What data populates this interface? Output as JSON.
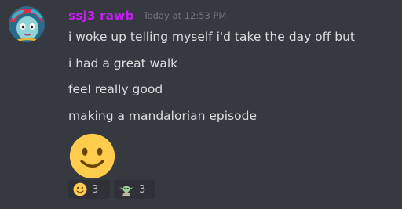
{
  "message": {
    "author": "ssj3 rawb",
    "author_color": "#c31ff0",
    "timestamp": "Today at 12:53 PM",
    "lines": [
      "i woke up telling myself i'd take the day off but",
      "i had a great walk",
      "feel really good",
      "making a mandalorian episode"
    ],
    "big_emoji": "slightly-smiling-face-icon"
  },
  "reactions": [
    {
      "emoji": "slightly-smiling-face-icon",
      "count": "3"
    },
    {
      "emoji": "grogu-baby-yoda-icon",
      "count": "3"
    }
  ],
  "colors": {
    "background": "#36393f",
    "text": "#dcddde",
    "timestamp": "#72767d",
    "reaction_bg": "#2f3136"
  }
}
